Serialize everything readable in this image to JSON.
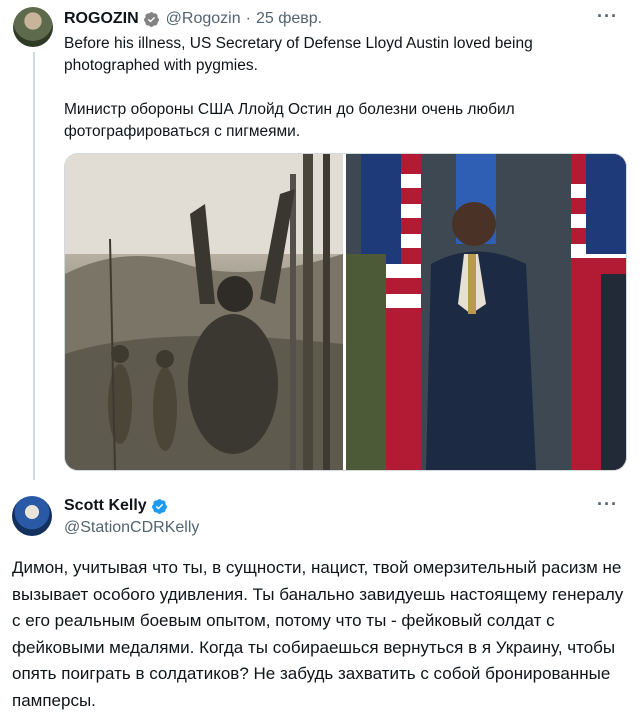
{
  "tweet1": {
    "display_name": "ROGOZIN",
    "handle": "@Rogozin",
    "separator": "·",
    "date": "25 февр.",
    "more": "···",
    "text_en": "Before his illness, US Secretary of Defense Lloyd Austin loved being photographed with pygmies.",
    "text_ru": "Министр обороны США Ллойд Остин до болезни очень любил фотографироваться с пигмеями."
  },
  "tweet2": {
    "display_name": "Scott Kelly",
    "handle": "@StationCDRKelly",
    "more": "···",
    "text": "Димон, учитывая что ты, в сущности, нацист, твой омерзительный расизм не вызывает особого удивления. Ты банально завидуешь настоящему генералу с его реальным боевым опытом,  потому что ты - фейковый солдат с фейковыми медалями. Когда ты собираешься вернуться в я Украину, чтобы опять поиграть в солдатиков? Не забудь захватить с собой бронированные памперсы."
  },
  "colors": {
    "verified_blue": "#1d9bf0",
    "secondary_text": "#536471",
    "thread_line": "#cfd9de"
  },
  "icons": {
    "verified": "verified-badge-icon",
    "more": "more-icon"
  }
}
